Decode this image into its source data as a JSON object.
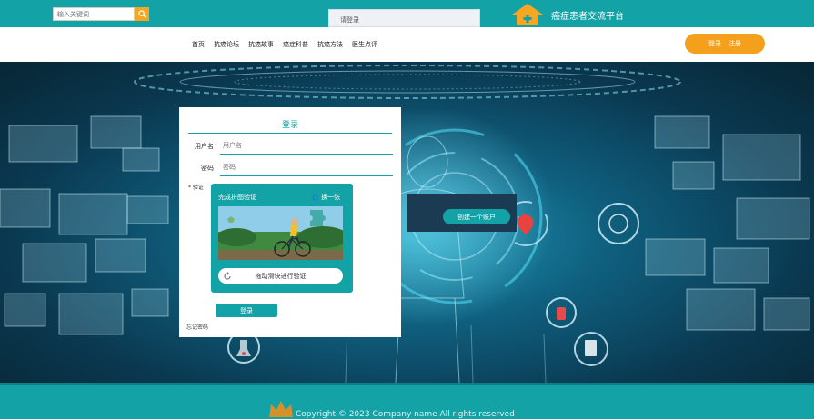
{
  "header": {
    "search_placeholder": "输入关键词",
    "notice_text": "请登录",
    "brand_title": "癌症患者交流平台",
    "brand_icon": "house-plus-icon"
  },
  "nav": {
    "items": [
      "首页",
      "抗癌论坛",
      "抗癌故事",
      "癌症科普",
      "抗癌方法",
      "医生点评"
    ],
    "login_label": "登录",
    "register_label": "注册"
  },
  "login": {
    "title": "登录",
    "username_label": "用户名",
    "username_placeholder": "用户名",
    "password_label": "密码",
    "password_placeholder": "密码",
    "captcha_label": "* 验证",
    "captcha_title": "完成拼图验证",
    "refresh_label": "换一张",
    "slider_text": "拖动滑块进行验证",
    "submit_label": "登录",
    "forgot_label": "忘记密码"
  },
  "register": {
    "button_label": "创建一个账户"
  },
  "footer": {
    "copyright": "Copyright © 2023 Company name All rights reserved"
  },
  "colors": {
    "primary": "#13a2a6",
    "accent": "#f5a01c",
    "dark_panel": "#1b3b53"
  }
}
